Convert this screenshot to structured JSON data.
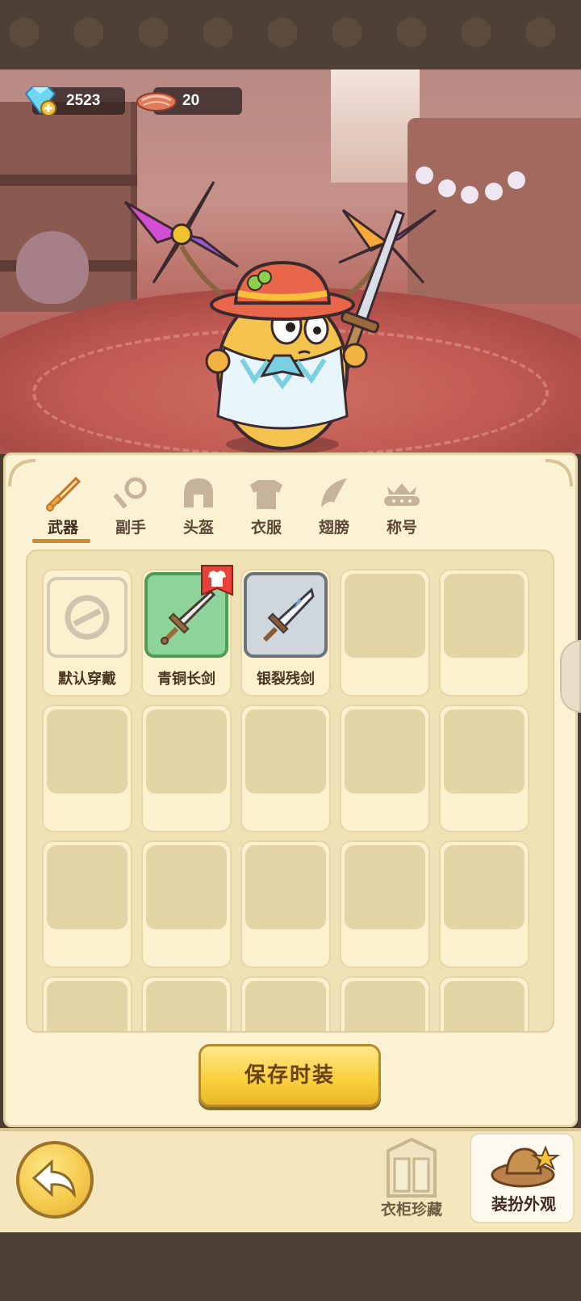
{
  "currency": {
    "gems": "2523",
    "meat": "20"
  },
  "tabs": [
    {
      "label": "武器",
      "icon": "sword-icon",
      "active": true
    },
    {
      "label": "副手",
      "icon": "offhand-icon",
      "active": false
    },
    {
      "label": "头盔",
      "icon": "helmet-icon",
      "active": false
    },
    {
      "label": "衣服",
      "icon": "armor-icon",
      "active": false
    },
    {
      "label": "翅膀",
      "icon": "wings-icon",
      "active": false
    },
    {
      "label": "称号",
      "icon": "title-crown-icon",
      "active": false
    }
  ],
  "items": [
    {
      "label": "默认穿戴",
      "style": "default",
      "icon": "prohibited-icon"
    },
    {
      "label": "青铜长剑",
      "style": "green",
      "icon": "bronze-sword-icon",
      "badge": "outfit-badge-icon"
    },
    {
      "label": "银裂残剑",
      "style": "gray",
      "icon": "silver-sword-icon"
    }
  ],
  "save_button": "保存时装",
  "bottom": {
    "wardrobe_label": "衣柜珍藏",
    "dress_up_label": "装扮外观"
  },
  "colors": {
    "panel": "#fbf2d4",
    "tab_underline": "#d08a2e",
    "green_item": "#8ed49a",
    "gray_item": "#cfd6dc",
    "button_yellow": "#f9cf3b"
  }
}
